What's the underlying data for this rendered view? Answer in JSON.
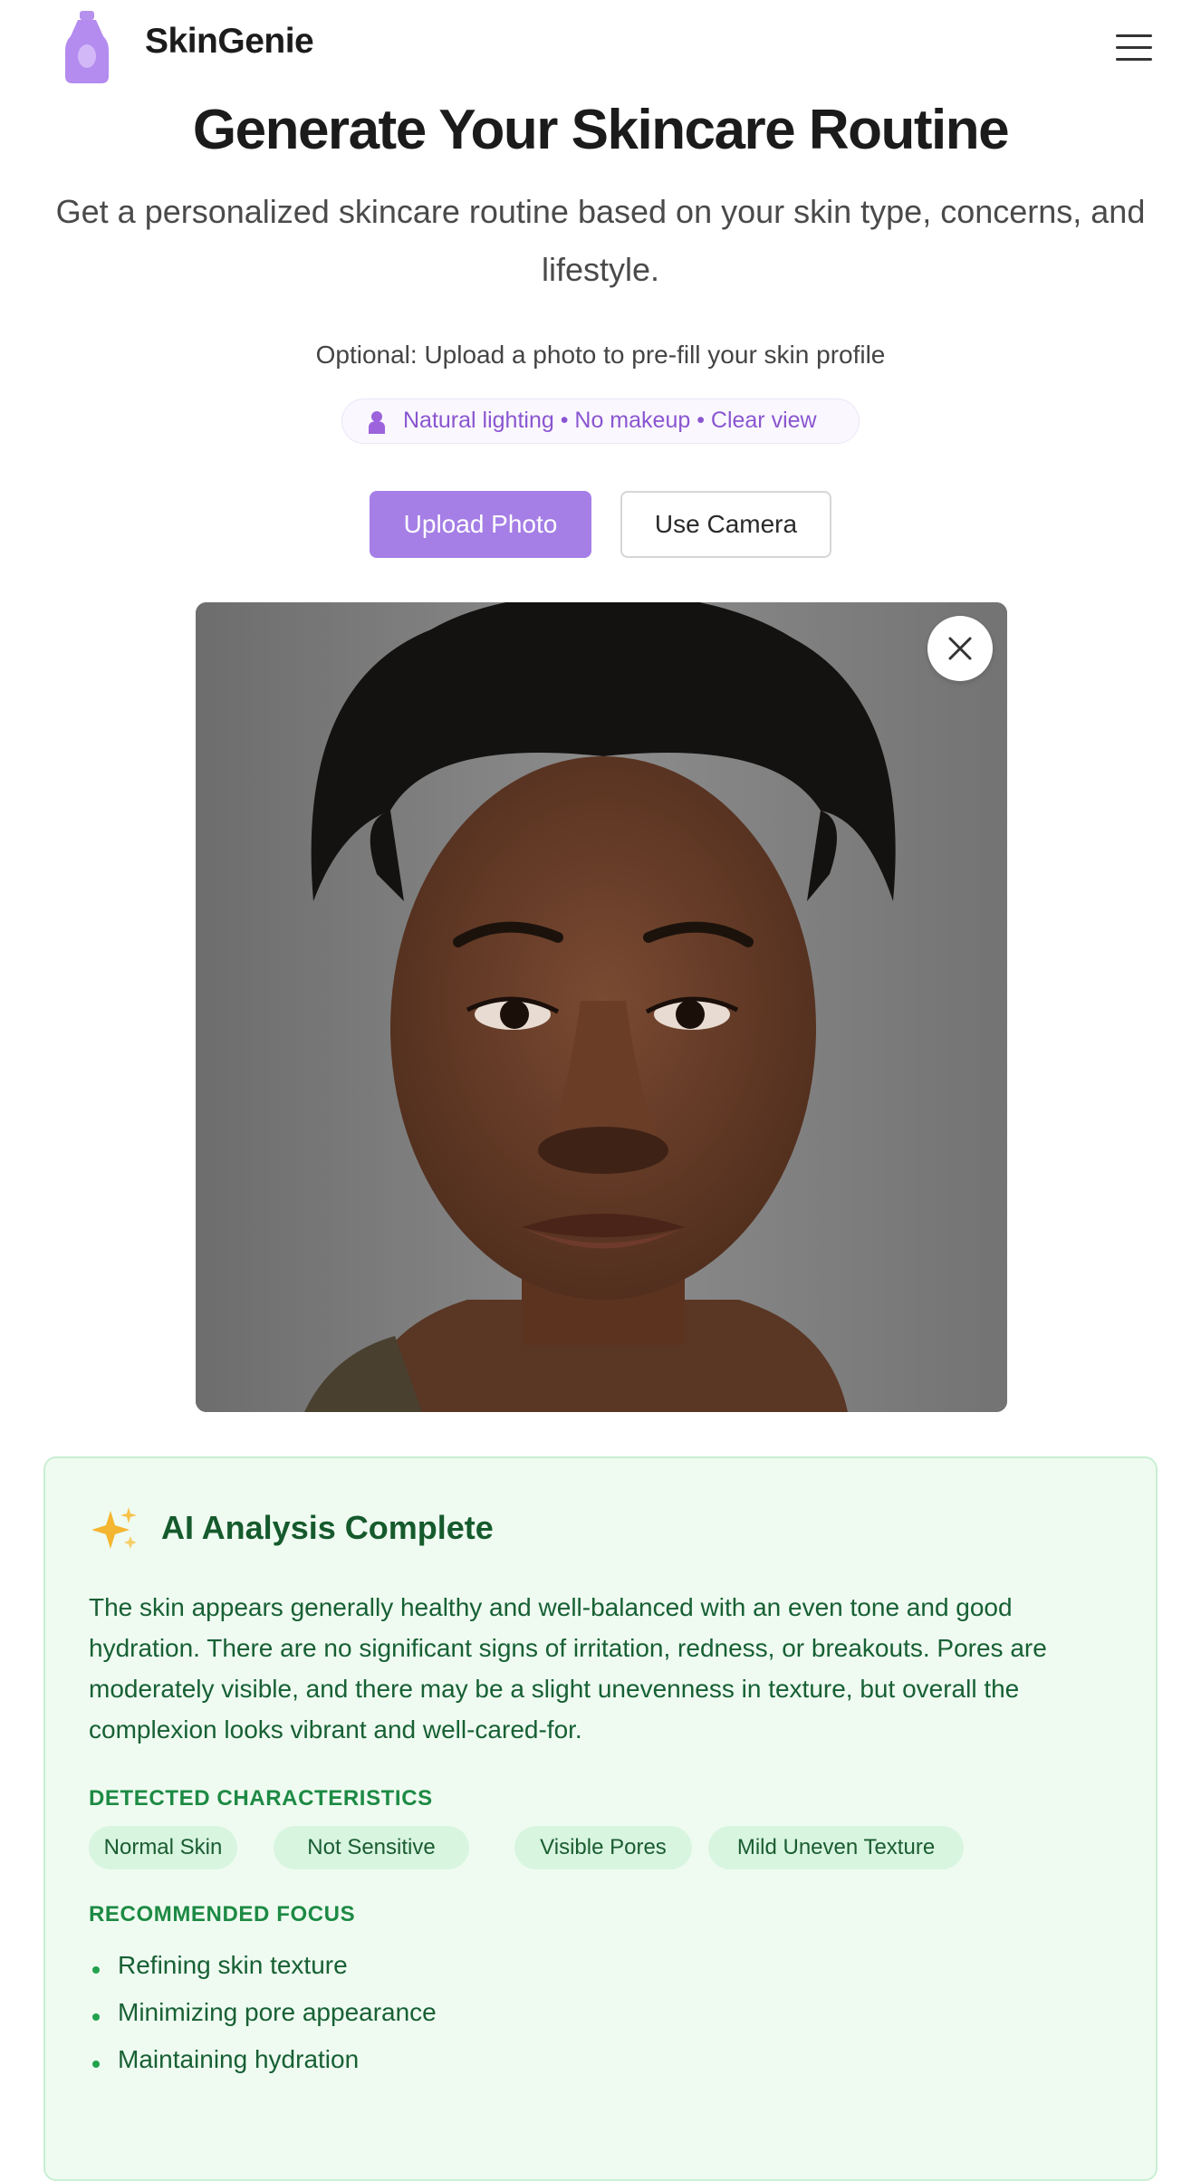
{
  "header": {
    "brand": "SkinGenie",
    "logo_icon": "serum-bottle-icon",
    "menu_icon": "hamburger-menu-icon"
  },
  "hero": {
    "title": "Generate Your Skincare Routine",
    "subtitle": "Get a personalized skincare routine based on your skin type, concerns, and lifestyle."
  },
  "upload": {
    "optional_text": "Optional: Upload a photo to pre-fill your skin profile",
    "tips": "Natural lighting • No makeup • Clear view",
    "tips_icon": "person-icon",
    "upload_label": "Upload Photo",
    "camera_label": "Use Camera",
    "close_icon": "close-icon"
  },
  "analysis": {
    "icon": "sparkles-icon",
    "title": "AI Analysis Complete",
    "description": "The skin appears generally healthy and well-balanced with an even tone and good hydration. There are no significant signs of irritation, redness, or breakouts. Pores are moderately visible, and there may be a slight unevenness in texture, but overall the complexion looks vibrant and well-cared-for.",
    "characteristics_label": "DETECTED CHARACTERISTICS",
    "characteristics": [
      "Normal Skin",
      "Not Sensitive",
      "Visible Pores",
      "Mild Uneven Texture"
    ],
    "focus_label": "RECOMMENDED FOCUS",
    "focus": [
      "Refining skin texture",
      "Minimizing pore appearance",
      "Maintaining hydration"
    ]
  },
  "colors": {
    "accent": "#a57ee6",
    "tips_text": "#8a55d0",
    "analysis_bg": "#effbf1",
    "analysis_text": "#176034",
    "chip_bg": "#d8f5e0"
  }
}
